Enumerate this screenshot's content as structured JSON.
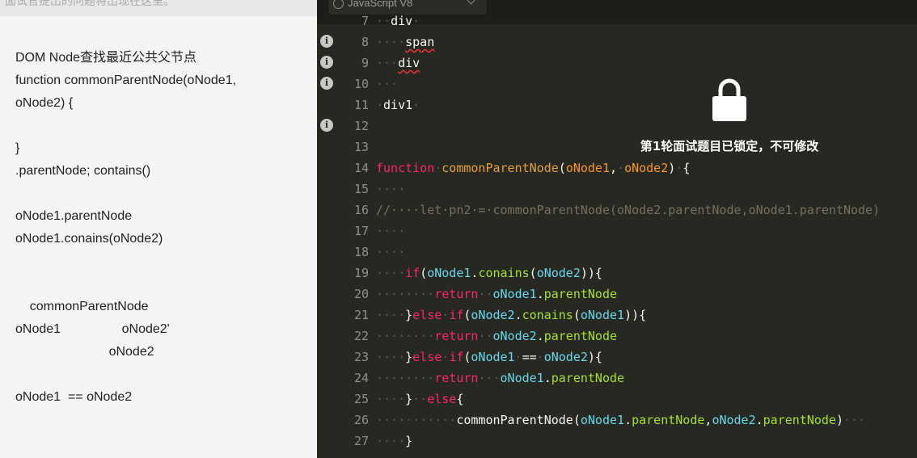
{
  "question_panel": {
    "top_text": "面试官提出的问题将出现在这里。",
    "lines": [
      "DOM Node查找最近公共父节点",
      "function commonParentNode(oNode1,",
      "oNode2) {",
      "",
      "}",
      ".parentNode; contains()",
      "",
      "oNode1.parentNode",
      "oNode1.conains(oNode2)",
      "",
      "",
      "    commonParentNode",
      "oNode1                 oNode2'",
      "                          oNode2",
      "",
      "oNode1  == oNode2"
    ]
  },
  "editor": {
    "language": "JavaScript V8",
    "lock_message": "第1轮面试题目已锁定，不可修改",
    "line_numbers": [
      "7",
      "8",
      "9",
      "10",
      "11",
      "12",
      "13",
      "14",
      "15",
      "16",
      "17",
      "18",
      "19",
      "20",
      "21",
      "22",
      "23",
      "24",
      "25",
      "26",
      "27"
    ],
    "lines": {
      "l7": "div",
      "l8": "span",
      "l9": "div",
      "l11": "div1",
      "l14_kw": "function",
      "l14_fn": "commonParentNode",
      "l14_p1": "oNode1",
      "l14_p2": "oNode2",
      "l16": "//····let·pn2·=·commonParentNode(oNode2.parentNode,oNode1.parentNode)",
      "if": "if",
      "else": "else",
      "return": "return",
      "conains": "conains",
      "parentNode": "parentNode",
      "oNode1": "oNode1",
      "oNode2": "oNode2",
      "call": "commonParentNode"
    }
  }
}
